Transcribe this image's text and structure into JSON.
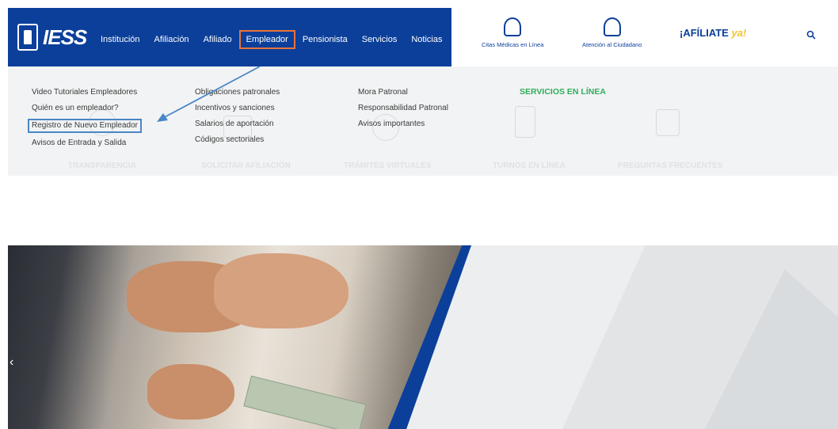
{
  "brand": {
    "logo_text": "IESS"
  },
  "nav": {
    "items": [
      "Institución",
      "Afiliación",
      "Afiliado",
      "Empleador",
      "Pensionista",
      "Servicios",
      "Noticias"
    ],
    "active_index": 3
  },
  "top_links": {
    "citas": "Citas Médicas en Línea",
    "atencion": "Atención al Ciudadano",
    "afiliate": "¡AFÍLIATE",
    "afiliate_ya": "ya!"
  },
  "megamenu": {
    "col1": [
      "Video Tutoriales Empleadores",
      "Quién es un empleador?",
      "Registro de Nuevo Empleador",
      "Avisos de Entrada y Salida"
    ],
    "col2": [
      "Obligaciones patronales",
      "Incentivos y sanciones",
      "Salarios de aportación",
      "Códigos sectoriales"
    ],
    "col3": [
      "Mora Patronal",
      "Responsabilidad Patronal",
      "Avisos importantes"
    ],
    "services_title": "SERVICIOS EN LÍNEA",
    "highlighted_item": "Registro de Nuevo Empleador"
  },
  "background_services": [
    "TRANSPARENCIA",
    "SOLICITAR AFILIACIÓN",
    "TRÁMITES VIRTUALES",
    "TURNOS EN LÍNEA",
    "PREGUNTAS FRECUENTES"
  ],
  "hero": {
    "prev_arrow": "‹"
  },
  "colors": {
    "brand_blue": "#0b3f9a",
    "highlight_orange": "#e9733a",
    "highlight_blue": "#4a86c5",
    "services_green": "#2fae5c"
  },
  "icons": [
    "search-icon",
    "doctor-icon",
    "user-icon",
    "shield-emblem-icon"
  ]
}
